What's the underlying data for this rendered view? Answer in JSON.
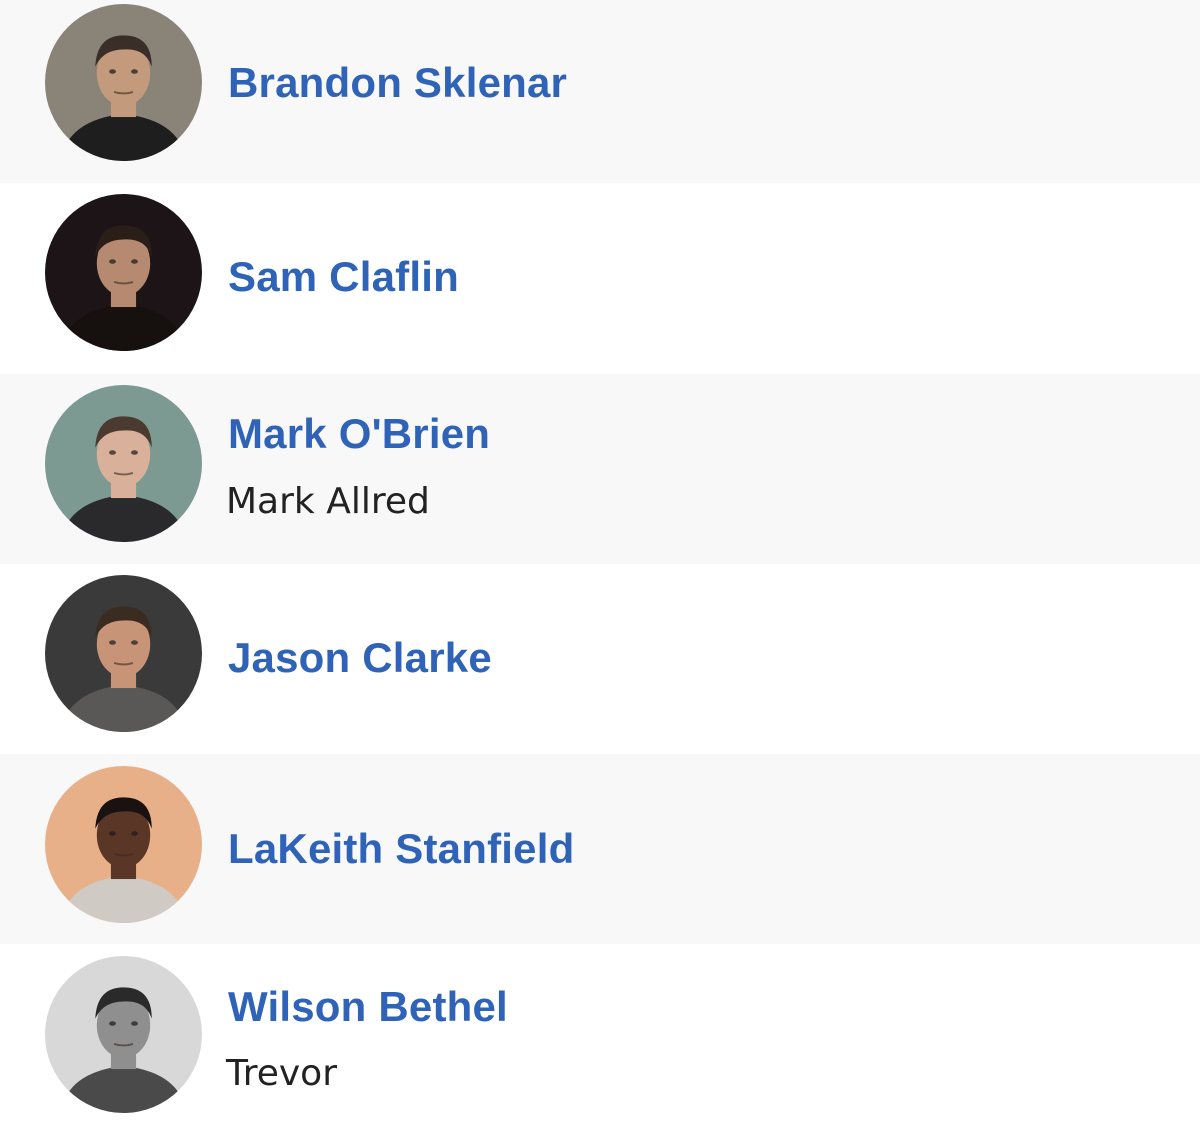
{
  "cast": [
    {
      "name": "Brandon Sklenar",
      "character": "",
      "photo_tone": "#8a8478",
      "photo_skin": "#c49a7c",
      "photo_hair": "#3a2f28",
      "photo_shirt": "#1e1e1e"
    },
    {
      "name": "Sam Claflin",
      "character": "",
      "photo_tone": "#1c1416",
      "photo_skin": "#b58a70",
      "photo_hair": "#2b1e18",
      "photo_shirt": "#16110f"
    },
    {
      "name": "Mark O'Brien",
      "character": "Mark Allred",
      "photo_tone": "#7d9a92",
      "photo_skin": "#d9b09a",
      "photo_hair": "#4a3a30",
      "photo_shirt": "#2a2a2c"
    },
    {
      "name": "Jason Clarke",
      "character": "",
      "photo_tone": "#3a3a3a",
      "photo_skin": "#c79478",
      "photo_hair": "#3b2c22",
      "photo_shirt": "#5a5856"
    },
    {
      "name": "LaKeith Stanfield",
      "character": "",
      "photo_tone": "#e8b089",
      "photo_skin": "#5a3626",
      "photo_hair": "#1a1210",
      "photo_shirt": "#cfcac4"
    },
    {
      "name": "Wilson Bethel",
      "character": "Trevor",
      "photo_tone": "#d8d8d8",
      "photo_skin": "#8f8f8f",
      "photo_hair": "#2a2a2a",
      "photo_shirt": "#4a4a4a"
    }
  ]
}
